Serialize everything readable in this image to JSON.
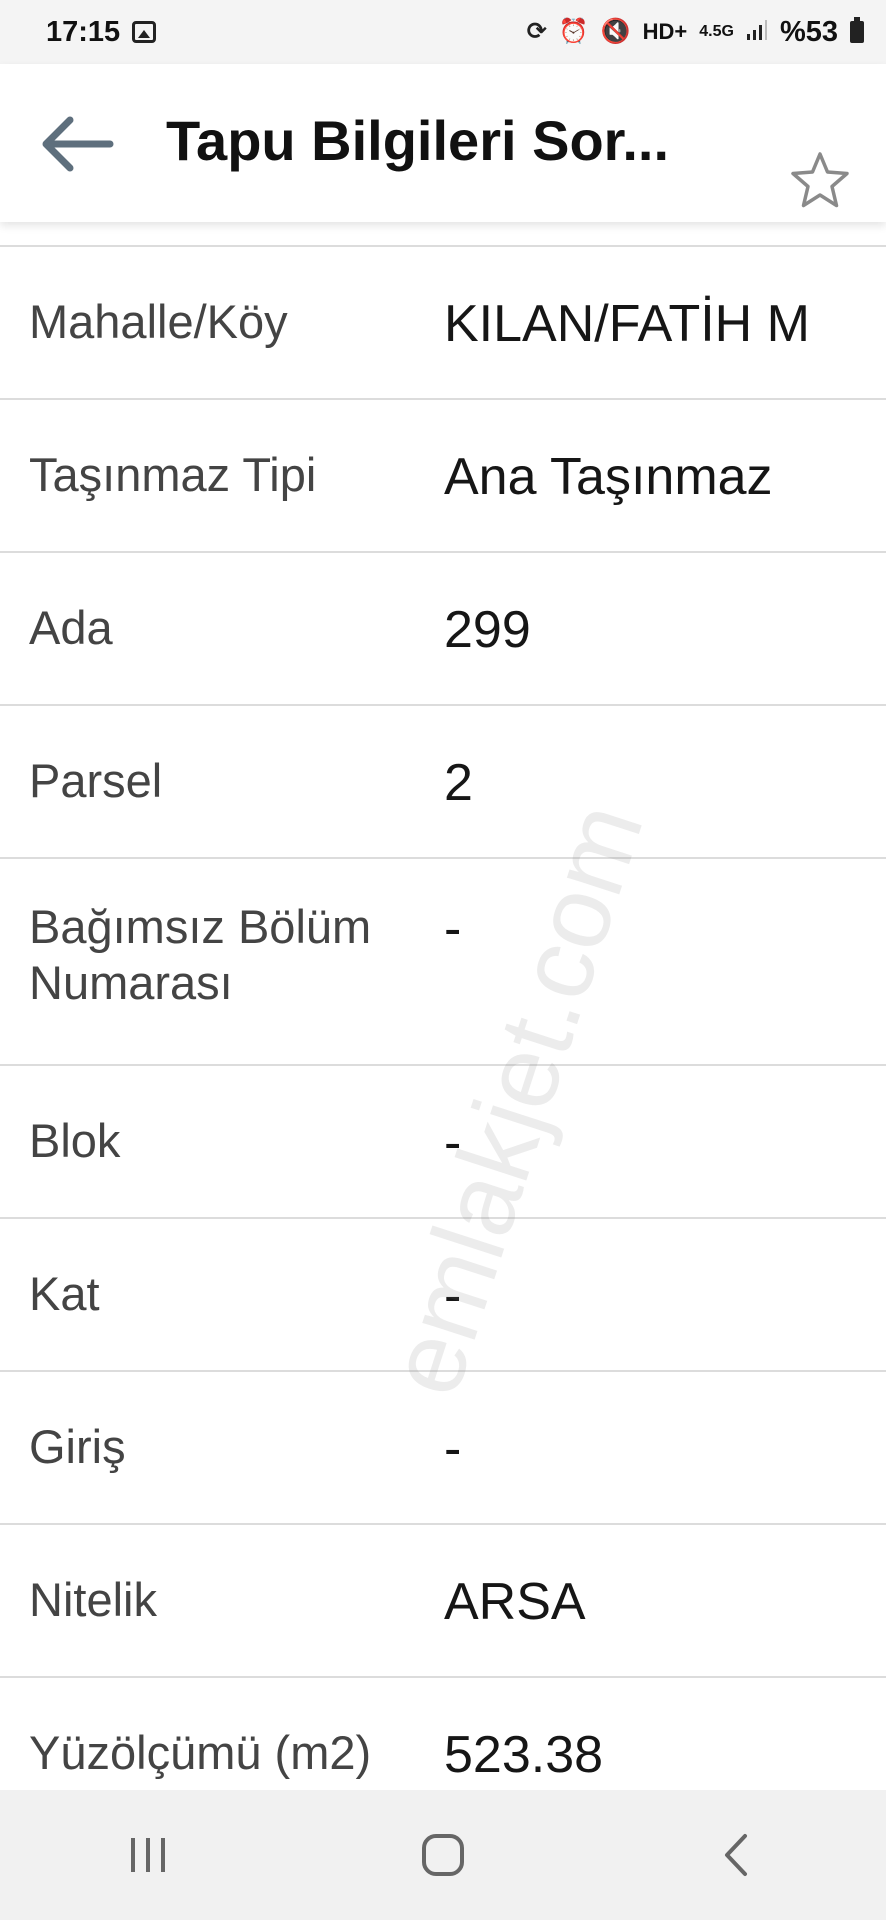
{
  "status_bar": {
    "time": "17:15",
    "network_label": "4.5G",
    "hd_label": "HD+",
    "battery": "%53"
  },
  "header": {
    "title": "Tapu Bilgileri Sor...",
    "icons": {
      "back": "arrow-left-icon",
      "favorite": "star-outline-icon"
    }
  },
  "fields": [
    {
      "label": "Mahalle/Köy",
      "value": "KILAN/FATİH M"
    },
    {
      "label": "Taşınmaz Tipi",
      "value": "Ana Taşınmaz"
    },
    {
      "label": "Ada",
      "value": "299"
    },
    {
      "label": "Parsel",
      "value": "2"
    },
    {
      "label": "Bağımsız Bölüm Numarası",
      "value": "-"
    },
    {
      "label": "Blok",
      "value": "-"
    },
    {
      "label": "Kat",
      "value": "-"
    },
    {
      "label": "Giriş",
      "value": "-"
    },
    {
      "label": "Nitelik",
      "value": "ARSA"
    },
    {
      "label": "Yüzölçümü (m2)",
      "value": "523.38"
    }
  ],
  "watermark": "emlakjet.com",
  "nav_bar": {
    "icons": [
      "recent-apps-icon",
      "home-icon",
      "back-icon"
    ]
  },
  "colors": {
    "divider": "#dcdcdc",
    "label": "#444444",
    "value": "#161616",
    "nav_bg": "#f1f1f1"
  }
}
